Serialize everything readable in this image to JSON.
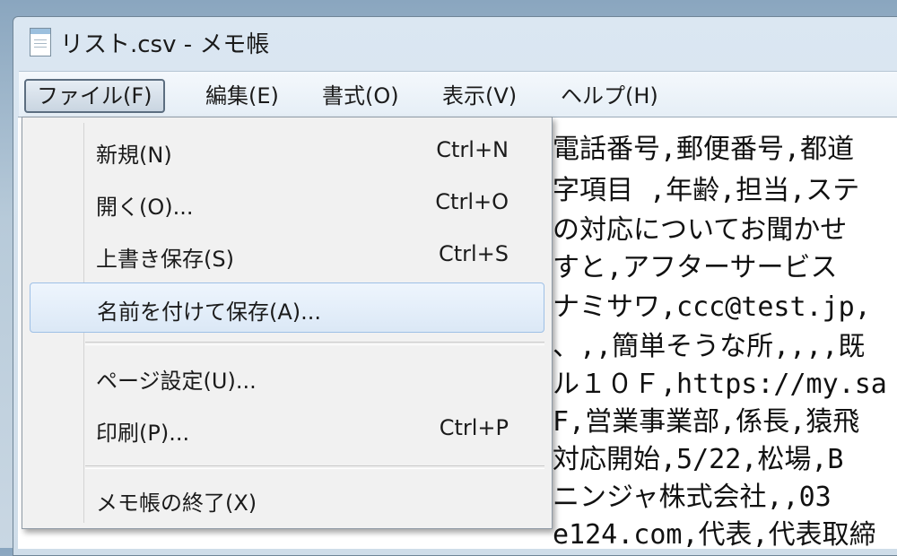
{
  "window": {
    "title": "リスト.csv - メモ帳"
  },
  "menubar": {
    "items": [
      {
        "label": "ファイル(F)"
      },
      {
        "label": "編集(E)"
      },
      {
        "label": "書式(O)"
      },
      {
        "label": "表示(V)"
      },
      {
        "label": "ヘルプ(H)"
      }
    ]
  },
  "file_menu": {
    "items": [
      {
        "label": "新規(N)",
        "shortcut": "Ctrl+N"
      },
      {
        "label": "開く(O)...",
        "shortcut": "Ctrl+O"
      },
      {
        "label": "上書き保存(S)",
        "shortcut": "Ctrl+S"
      },
      {
        "label": "名前を付けて保存(A)...",
        "shortcut": ""
      },
      {
        "label": "ページ設定(U)...",
        "shortcut": ""
      },
      {
        "label": "印刷(P)...",
        "shortcut": "Ctrl+P"
      },
      {
        "label": "メモ帳の終了(X)",
        "shortcut": ""
      }
    ]
  },
  "editor": {
    "lines": [
      "電話番号,郵便番号,都道",
      "字項目 ,年齢,担当,ステ",
      "の対応についてお聞かせ",
      "すと,アフターサービス",
      "ナミサワ,ccc@test.jp,",
      "、,,簡単そうな所,,,,既",
      "ル１０Ｆ,https://my.sa",
      "F,営業事業部,係長,猿飛",
      " 対応開始,5/22,松場,B",
      " ニンジャ株式会社,,03",
      "e124.com,代表,代表取締",
      ""
    ]
  },
  "colors": {
    "menu_hover_bg": "#dbe8f6",
    "menu_hover_border": "#9ec0e6",
    "dropdown_bg": "#f1f1f1"
  },
  "icons": {
    "app": "notepad-icon"
  }
}
